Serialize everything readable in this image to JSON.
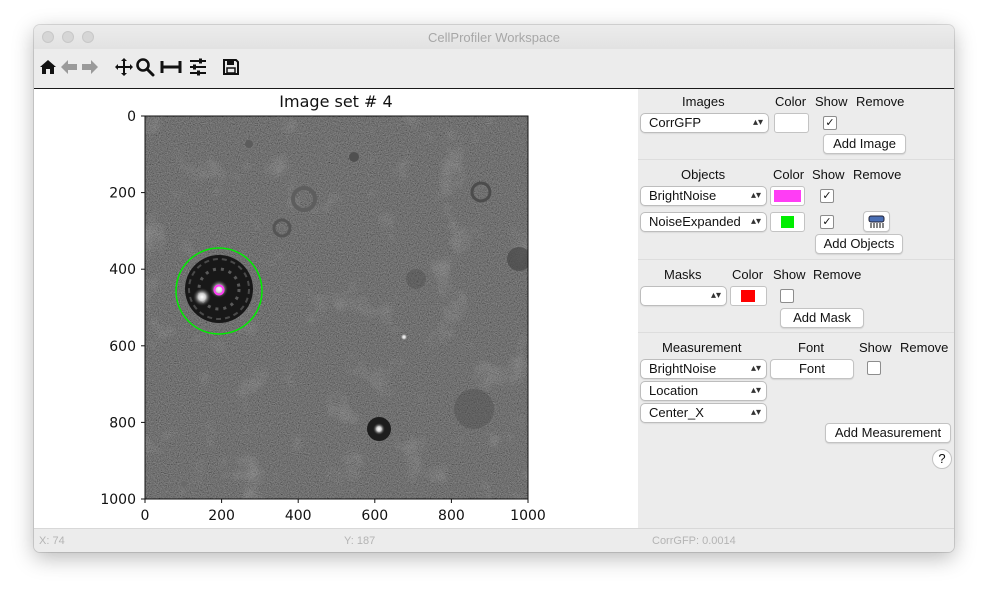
{
  "window": {
    "title": "CellProfiler Workspace"
  },
  "toolbar": {
    "items": [
      "home-icon",
      "back-arrow-icon",
      "forward-arrow-icon",
      "pan-icon",
      "zoom-icon",
      "subplots-icon",
      "configure-icon",
      "save-icon"
    ]
  },
  "plot": {
    "title": "Image set # 4",
    "x_ticks": [
      "0",
      "200",
      "400",
      "600",
      "800",
      "1000"
    ],
    "y_ticks": [
      "0",
      "200",
      "400",
      "600",
      "800",
      "1000"
    ]
  },
  "panel": {
    "images": {
      "header": "Images",
      "color_header": "Color",
      "show_header": "Show",
      "remove_header": "Remove",
      "rows": [
        {
          "name": "CorrGFP",
          "color": "#ffffff",
          "show": "✓"
        }
      ],
      "add_label": "Add Image"
    },
    "objects": {
      "header": "Objects",
      "color_header": "Color",
      "show_header": "Show",
      "remove_header": "Remove",
      "rows": [
        {
          "name": "BrightNoise",
          "color": "#ff3df5",
          "show": "✓"
        },
        {
          "name": "NoiseExpanded",
          "color": "#00ee00",
          "show": "✓"
        }
      ],
      "add_label": "Add Objects"
    },
    "masks": {
      "header": "Masks",
      "color_header": "Color",
      "show_header": "Show",
      "remove_header": "Remove",
      "rows": [
        {
          "name": "",
          "color": "#ff0000",
          "show": ""
        }
      ],
      "add_label": "Add Mask"
    },
    "measurement": {
      "header": "Measurement",
      "font_header": "Font",
      "show_header": "Show",
      "remove_header": "Remove",
      "selects": [
        "BrightNoise",
        "Location",
        "Center_X"
      ],
      "font_label": "Font",
      "show": "",
      "add_label": "Add Measurement"
    },
    "help_label": "?"
  },
  "status": {
    "x": "X: 74",
    "y": "Y: 187",
    "value": "CorrGFP: 0.0014"
  }
}
